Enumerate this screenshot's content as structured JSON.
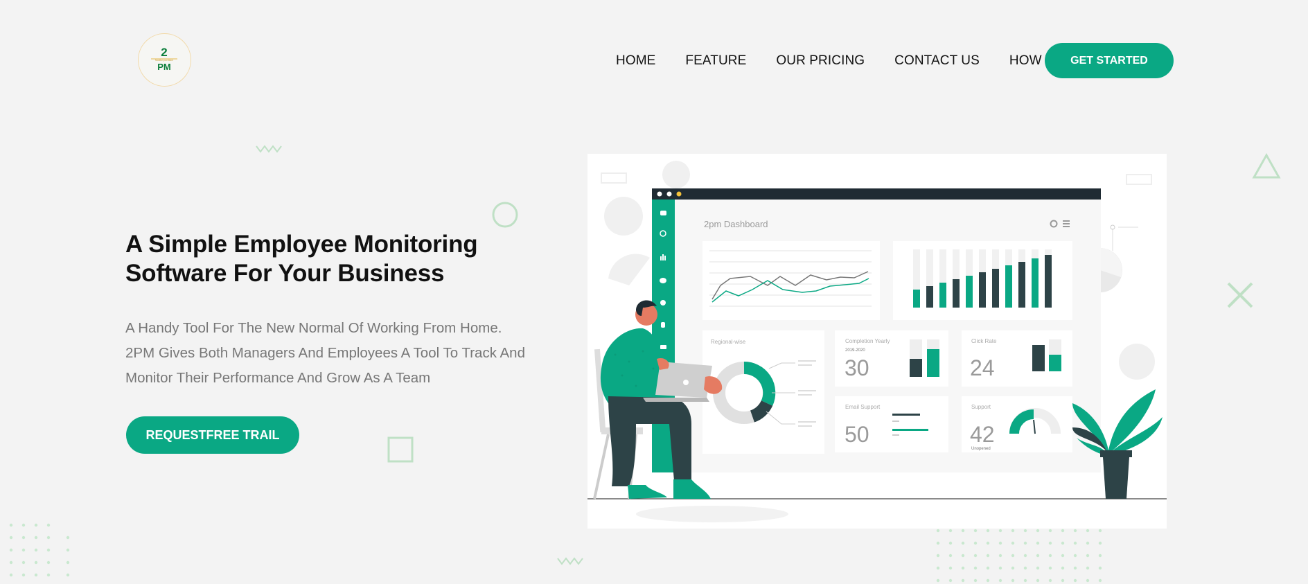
{
  "brand": {
    "logo_top": "2",
    "logo_bottom": "PM",
    "logo_tagline": "Monitor your team"
  },
  "nav": {
    "items": [
      "HOME",
      "FEATURE",
      "OUR PRICING",
      "CONTACT US",
      "HOW TO"
    ],
    "cta": "GET STARTED"
  },
  "hero": {
    "title_line1": "A Simple Employee Monitoring",
    "title_line2": "Software For Your Business",
    "sub_line1": "A Handy Tool For The New Normal Of Working From Home.",
    "sub_line2": "2PM Gives Both Managers And Employees A Tool To Track And",
    "sub_line3": "Monitor Their Performance And Grow As A Team",
    "cta": "REQUESTFREE TRAIL"
  },
  "dashboard": {
    "title": "2pm Dashboard",
    "cards": {
      "regional": {
        "label": "Regional-wise"
      },
      "completion": {
        "label": "Completion Yearly",
        "period": "2019-2020",
        "value": "30"
      },
      "click_rate": {
        "label": "Click Rate",
        "value": "24"
      },
      "email_support": {
        "label": "Email Support",
        "value": "50"
      },
      "support": {
        "label": "Support",
        "value": "42",
        "note": "Unopened"
      }
    }
  },
  "colors": {
    "accent": "#0aa884",
    "dark": "#2d4347",
    "background": "#f3f3f3"
  }
}
